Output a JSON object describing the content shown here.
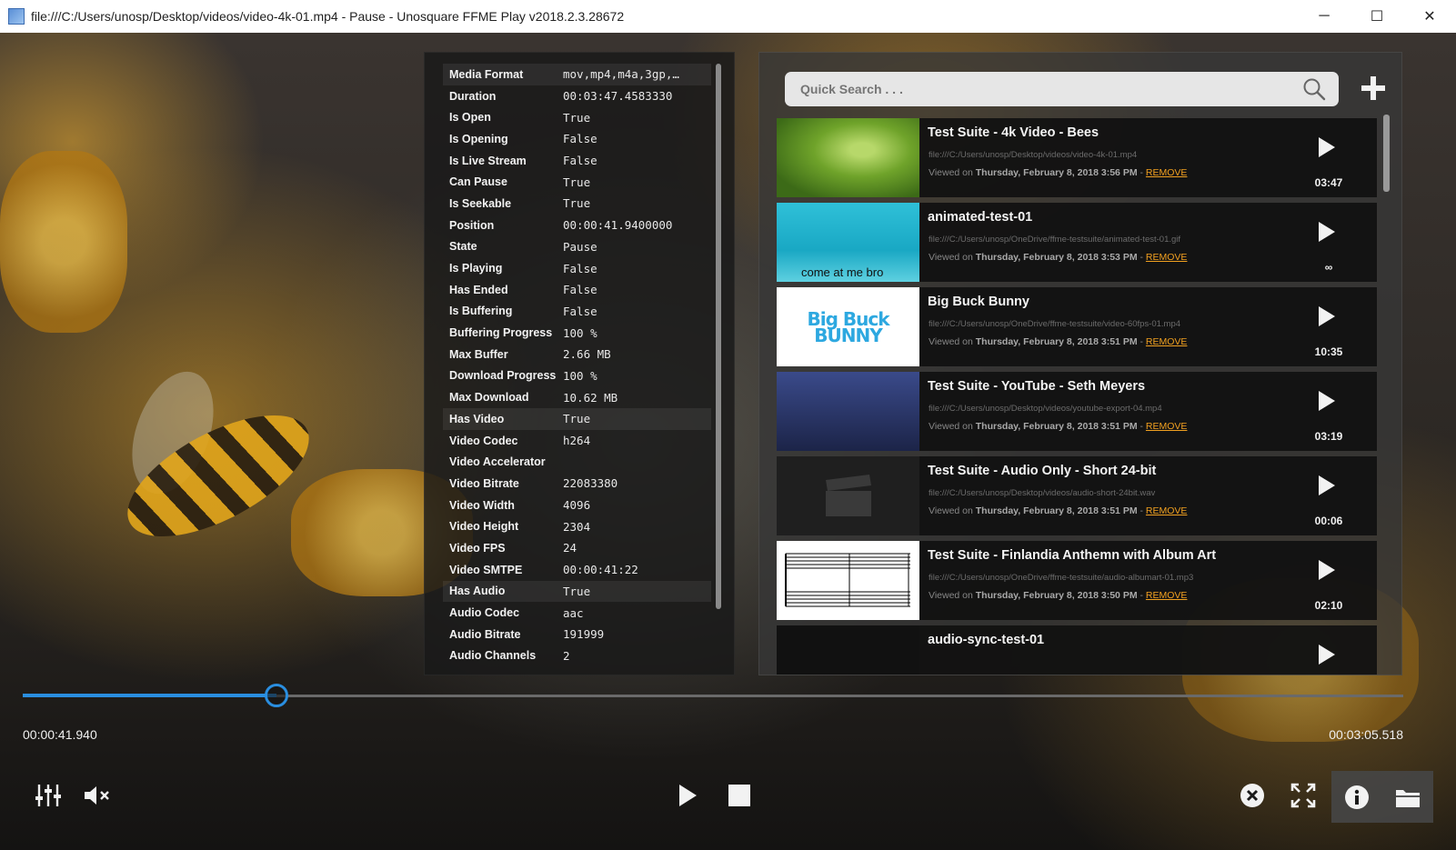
{
  "window": {
    "title": "file:///C:/Users/unosp/Desktop/videos/video-4k-01.mp4 - Pause - Unosquare FFME Play v2018.2.3.28672",
    "minimize": "─",
    "maximize": "☐",
    "close": "✕"
  },
  "info": {
    "rows": [
      {
        "key": "Media Format",
        "value": "mov,mp4,m4a,3gp,…"
      },
      {
        "key": "Duration",
        "value": "00:03:47.4583330"
      },
      {
        "key": "Is Open",
        "value": "True"
      },
      {
        "key": "Is Opening",
        "value": "False"
      },
      {
        "key": "Is Live Stream",
        "value": "False"
      },
      {
        "key": "Can Pause",
        "value": "True"
      },
      {
        "key": "Is Seekable",
        "value": "True"
      },
      {
        "key": "Position",
        "value": "00:00:41.9400000"
      },
      {
        "key": "State",
        "value": "Pause"
      },
      {
        "key": "Is Playing",
        "value": "False"
      },
      {
        "key": "Has Ended",
        "value": "False"
      },
      {
        "key": "Is Buffering",
        "value": "False"
      },
      {
        "key": "Buffering Progress",
        "value": "100 %"
      },
      {
        "key": "Max Buffer",
        "value": "2.66 MB"
      },
      {
        "key": "Download Progress",
        "value": "100 %"
      },
      {
        "key": "Max Download",
        "value": "10.62 MB"
      },
      {
        "key": "Has Video",
        "value": "True"
      },
      {
        "key": "Video Codec",
        "value": "h264"
      },
      {
        "key": "Video Accelerator",
        "value": ""
      },
      {
        "key": "Video Bitrate",
        "value": "22083380"
      },
      {
        "key": "Video Width",
        "value": "4096"
      },
      {
        "key": "Video Height",
        "value": "2304"
      },
      {
        "key": "Video FPS",
        "value": "24"
      },
      {
        "key": "Video SMTPE",
        "value": "00:00:41:22"
      },
      {
        "key": "Has Audio",
        "value": "True"
      },
      {
        "key": "Audio Codec",
        "value": "aac"
      },
      {
        "key": "Audio Bitrate",
        "value": "191999"
      },
      {
        "key": "Audio Channels",
        "value": "2"
      }
    ]
  },
  "playlist": {
    "search_placeholder": "Quick Search . . .",
    "viewed_prefix": "Viewed on",
    "remove_label": "REMOVE",
    "items": [
      {
        "title": "Test Suite - 4k Video - Bees",
        "path": "file:///C:/Users/unosp/Desktop/videos/video-4k-01.mp4",
        "viewed": "Thursday, February 8, 2018 3:56 PM",
        "duration": "03:47",
        "thumb": "bees"
      },
      {
        "title": "animated-test-01",
        "path": "file:///C:/Users/unosp/OneDrive/ffme-testsuite/animated-test-01.gif",
        "viewed": "Thursday, February 8, 2018 3:53 PM",
        "duration": "∞",
        "thumb": "animated",
        "thumb_caption": "come at me bro"
      },
      {
        "title": "Big Buck Bunny",
        "path": "file:///C:/Users/unosp/OneDrive/ffme-testsuite/video-60fps-01.mp4",
        "viewed": "Thursday, February 8, 2018 3:51 PM",
        "duration": "10:35",
        "thumb": "bunny",
        "thumb_text": "Big Buck BUNNY"
      },
      {
        "title": "Test Suite - YouTube - Seth Meyers",
        "path": "file:///C:/Users/unosp/Desktop/videos/youtube-export-04.mp4",
        "viewed": "Thursday, February 8, 2018 3:51 PM",
        "duration": "03:19",
        "thumb": "tv"
      },
      {
        "title": "Test Suite - Audio Only - Short 24-bit",
        "path": "file:///C:/Users/unosp/Desktop/videos/audio-short-24bit.wav",
        "viewed": "Thursday, February 8, 2018 3:51 PM",
        "duration": "00:06",
        "thumb": "audio"
      },
      {
        "title": "Test Suite - Finlandia Anthemn with Album Art",
        "path": "file:///C:/Users/unosp/OneDrive/ffme-testsuite/audio-albumart-01.mp3",
        "viewed": "Thursday, February 8, 2018 3:50 PM",
        "duration": "02:10",
        "thumb": "music"
      },
      {
        "title": "audio-sync-test-01",
        "path": "",
        "viewed": "",
        "duration": "",
        "thumb": "sync"
      }
    ]
  },
  "playback": {
    "position_text": "00:00:41.940",
    "remaining_text": "00:03:05.518",
    "progress_fraction": 0.184
  },
  "colors": {
    "accent": "#2a8ee0",
    "remove_link": "#f0a020"
  },
  "controls": {
    "left": [
      "equalizer-icon",
      "mute-icon"
    ],
    "center": [
      "play-icon",
      "stop-icon"
    ],
    "right": [
      "close-media-icon",
      "fullscreen-icon",
      "info-icon",
      "open-folder-icon"
    ]
  }
}
